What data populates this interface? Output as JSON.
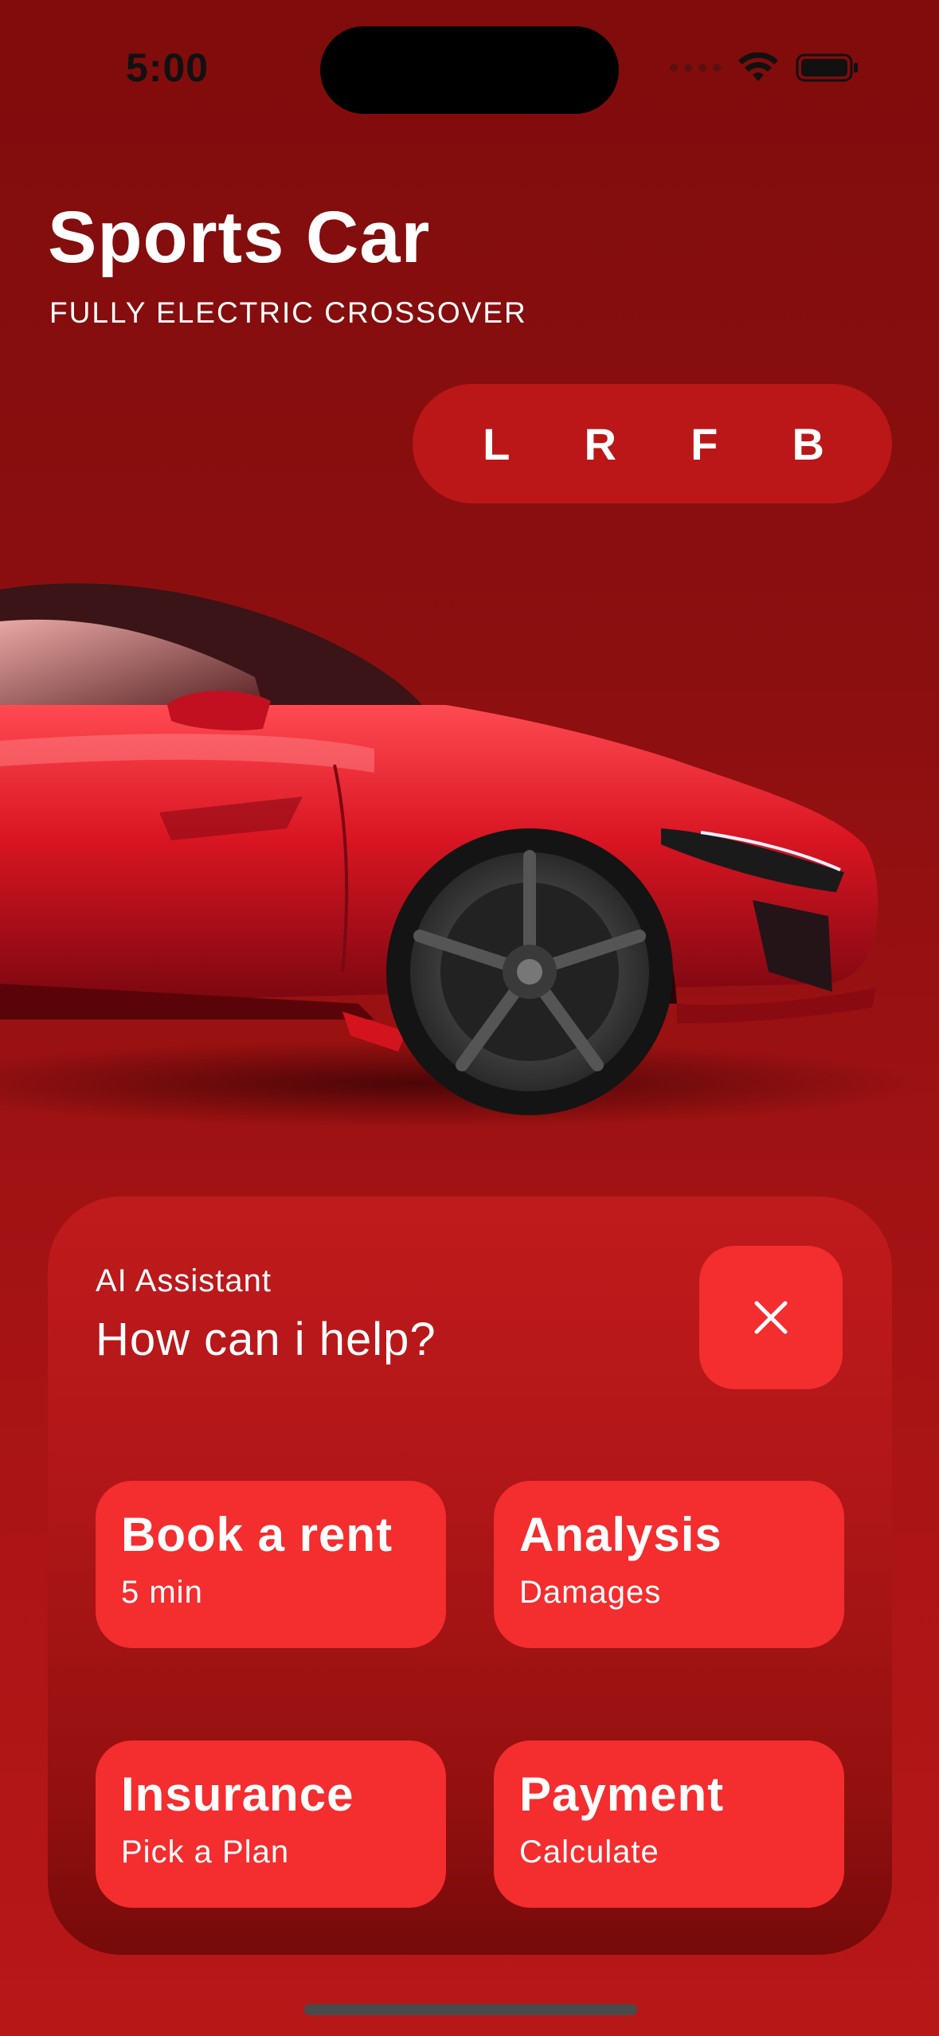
{
  "status_bar": {
    "time": "5:00"
  },
  "header": {
    "title": "Sports Car",
    "subtitle": "FULLY ELECTRIC CROSSOVER"
  },
  "view_selector": {
    "options": [
      "L",
      "R",
      "F",
      "B"
    ]
  },
  "assistant": {
    "label": "AI Assistant",
    "question": "How can i help?",
    "actions": [
      {
        "title": "Book a rent",
        "subtitle": "5 min"
      },
      {
        "title": "Analysis",
        "subtitle": "Damages"
      },
      {
        "title": "Insurance",
        "subtitle": "Pick a Plan"
      },
      {
        "title": "Payment",
        "subtitle": "Calculate"
      }
    ]
  },
  "colors": {
    "background": "#8d0f10",
    "accent": "#f42d2f",
    "selector_bg": "#bb1718"
  },
  "icons": {
    "close": "close-icon",
    "wifi": "wifi-icon",
    "battery": "battery-icon"
  }
}
